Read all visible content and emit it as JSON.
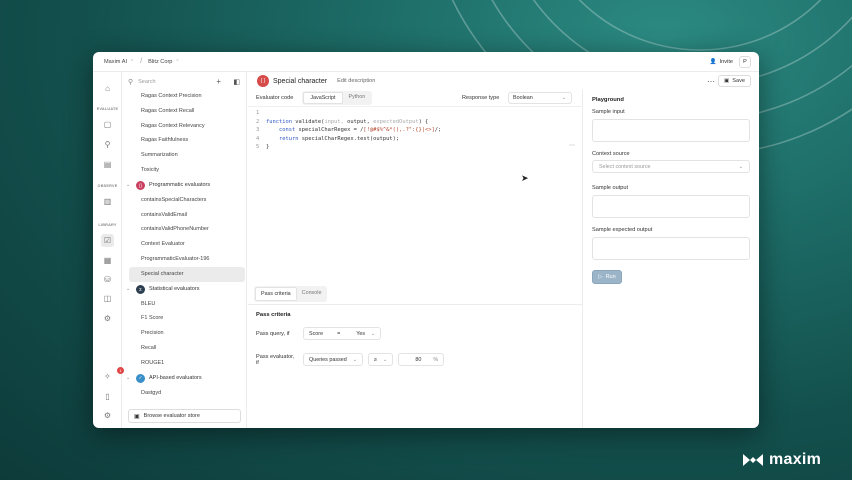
{
  "topbar": {
    "org": "Maxim AI",
    "workspace": "Blitz Corp",
    "invite": "Invite",
    "user_initial": "P"
  },
  "rail": {
    "sections": [
      "EVALUATE",
      "OBSERVE",
      "LIBRARY"
    ],
    "notification_count": "1"
  },
  "sidebar": {
    "search_placeholder": "Search",
    "items_top": [
      "Ragas Context Precision",
      "Ragas Context Recall",
      "Ragas Context Relevancy",
      "Ragas Faithfulness",
      "Summarization",
      "Toxicity"
    ],
    "group_programmatic": "Programmatic evaluators",
    "items_programmatic": [
      "containsSpecialCharacters",
      "containsValidEmail",
      "containsValidPhoneNumber",
      "Context Evaluator",
      "ProgrammaticEvaluator-196",
      "Special character"
    ],
    "group_statistical": "Statistical evaluators",
    "items_statistical": [
      "BLEU",
      "F1 Score",
      "Precision",
      "Recall",
      "ROUGE1"
    ],
    "group_api": "API-based evaluators",
    "item_partial": "Dastgyd",
    "store_button": "Browse evaluator store"
  },
  "header": {
    "icon_text": "{ }",
    "title": "Special character",
    "edit_description": "Edit description",
    "save": "Save"
  },
  "editor": {
    "label": "Evaluator code",
    "tabs": [
      "JavaScript",
      "Python"
    ],
    "response_type_label": "Response type",
    "response_type_value": "Boolean",
    "code_lines": [
      {
        "n": "1"
      },
      {
        "n": "2",
        "a": "function",
        "b": " validate(",
        "c": "input, ",
        "d": "output, ",
        "e": "expectedOutput",
        "f": ") {"
      },
      {
        "n": "3",
        "a": "    const",
        "b": " specialCharRegex = /",
        "s": "[!@#$%^&*(),.?\":{}|<>]",
        "f": "/;"
      },
      {
        "n": "4",
        "a": "    return",
        "b": " specialCharRegex.test(output);"
      },
      {
        "n": "5",
        "b": "}"
      }
    ]
  },
  "pass": {
    "tabs": [
      "Pass criteria",
      "Console"
    ],
    "heading": "Pass criteria",
    "query_label": "Pass query, if",
    "query_field": "Score",
    "query_op": "=",
    "query_value": "Yes",
    "eval_label": "Pass evaluator, if",
    "eval_field": "Queries passed",
    "eval_op": "≥",
    "eval_value": "80",
    "eval_unit": "%"
  },
  "playground": {
    "title": "Playground",
    "sample_input": "Sample input",
    "context_source": "Context source",
    "context_placeholder": "Select context source",
    "sample_output": "Sample output",
    "sample_expected": "Sample expected output",
    "run": "Run"
  },
  "brand": {
    "name": "maxim"
  }
}
